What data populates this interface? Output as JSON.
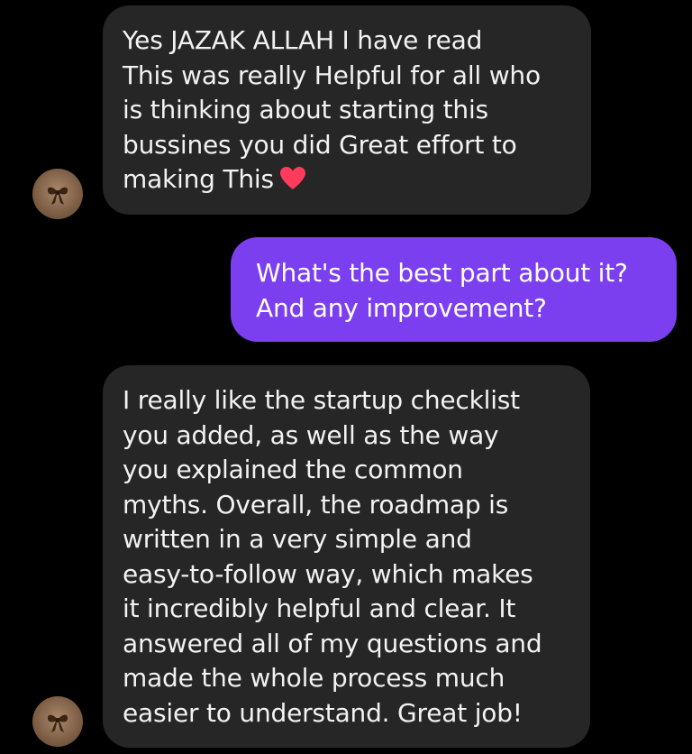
{
  "messages": [
    {
      "direction": "incoming",
      "text": "Yes JAZAK ALLAH I have read\nThis was really Helpful for all who\nis thinking about starting this\nbussines you did Great effort to\nmaking This",
      "trailing_emoji": "red-heart"
    },
    {
      "direction": "outgoing",
      "text": "What's the best part about it?\nAnd any improvement?"
    },
    {
      "direction": "incoming",
      "text": "I really like the startup checklist\nyou added, as well as the way\nyou explained the common\nmyths. Overall, the roadmap is\nwritten in a very simple and\neasy-to-follow way, which makes\nit incredibly helpful and clear. It\nanswered all of my questions and\nmade the whole process much\neasier to understand. Great job!"
    }
  ],
  "colors": {
    "background": "#000000",
    "incoming_bubble": "#262626",
    "outgoing_bubble": "#7b3fef",
    "heart": "#ff3b5c"
  },
  "avatar": {
    "icon": "bow-avatar-icon"
  }
}
